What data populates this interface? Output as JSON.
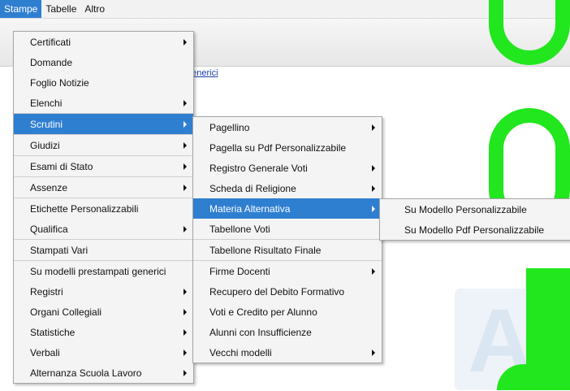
{
  "menubar": {
    "items": [
      "Stampe",
      "Tabelle",
      "Altro"
    ]
  },
  "background": {
    "link_text": "generici"
  },
  "main_menu": {
    "items": [
      {
        "label": "Certificati",
        "submenu": true
      },
      {
        "label": "Domande",
        "submenu": false
      },
      {
        "label": "Foglio Notizie",
        "submenu": false
      },
      {
        "label": "Elenchi",
        "submenu": true
      },
      {
        "label": "Scrutini",
        "submenu": true,
        "highlighted": true
      },
      {
        "label": "Giudizi",
        "submenu": true
      },
      {
        "label": "Esami di Stato",
        "submenu": true
      },
      {
        "label": "Assenze",
        "submenu": true
      },
      {
        "label": "Etichette Personalizzabili",
        "submenu": false
      },
      {
        "label": "Qualifica",
        "submenu": true
      },
      {
        "label": "Stampati Vari",
        "submenu": false
      },
      {
        "label": "Su modelli prestampati generici",
        "submenu": false
      },
      {
        "label": "Registri",
        "submenu": true
      },
      {
        "label": "Organi Collegiali",
        "submenu": true
      },
      {
        "label": "Statistiche",
        "submenu": true
      },
      {
        "label": "Verbali",
        "submenu": true
      },
      {
        "label": "Alternanza Scuola Lavoro",
        "submenu": true
      }
    ]
  },
  "scrutini_menu": {
    "items": [
      {
        "label": "Pagellino",
        "submenu": true
      },
      {
        "label": "Pagella su Pdf Personalizzabile",
        "submenu": false
      },
      {
        "label": "Registro Generale Voti",
        "submenu": true
      },
      {
        "label": "Scheda di Religione",
        "submenu": true
      },
      {
        "label": "Materia Alternativa",
        "submenu": true,
        "highlighted": true
      },
      {
        "label": "Tabellone Voti",
        "submenu": false
      },
      {
        "label": "Tabellone Risultato Finale",
        "submenu": false
      },
      {
        "label": "Firme Docenti",
        "submenu": true
      },
      {
        "label": "Recupero del Debito Formativo",
        "submenu": false
      },
      {
        "label": "Voti e Credito per Alunno",
        "submenu": false
      },
      {
        "label": "Alunni con Insufficienze",
        "submenu": false
      },
      {
        "label": "Vecchi modelli",
        "submenu": true
      }
    ]
  },
  "materia_menu": {
    "items": [
      {
        "label": "Su Modello Personalizzabile"
      },
      {
        "label": "Su Modello Pdf Personalizzabile"
      }
    ]
  },
  "colors": {
    "highlight": "#2f7fd1",
    "menu_bg": "#f4f4f4",
    "green_shapes": "#22e61e"
  }
}
